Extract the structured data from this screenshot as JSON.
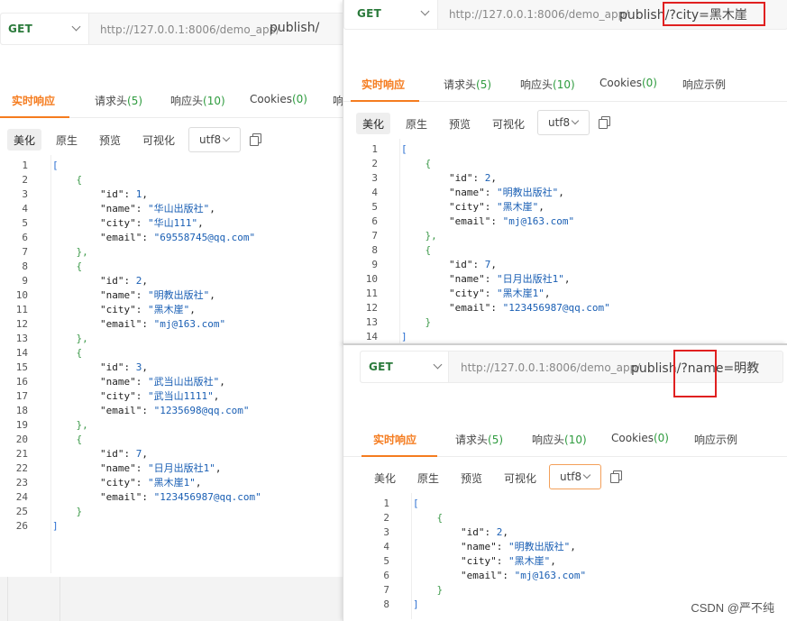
{
  "panels": [
    {
      "method": "GET",
      "host": "http://127.0.0.1:8006/demo_app/",
      "path": "publish/",
      "tabs": [
        {
          "label": "实时响应",
          "count": ""
        },
        {
          "label": "请求头",
          "count": "(5)"
        },
        {
          "label": "响应头",
          "count": "(10)"
        },
        {
          "label": "Cookies",
          "count": "(0)"
        },
        {
          "label": "响",
          "count": ""
        }
      ],
      "views": [
        "美化",
        "原生",
        "预览",
        "可视化"
      ],
      "encoding": "utf8",
      "code": [
        "[",
        "    {",
        "        \"id\": 1,",
        "        \"name\": \"华山出版社\",",
        "        \"city\": \"华山111\",",
        "        \"email\": \"69558745@qq.com\"",
        "    },",
        "    {",
        "        \"id\": 2,",
        "        \"name\": \"明教出版社\",",
        "        \"city\": \"黑木崖\",",
        "        \"email\": \"mj@163.com\"",
        "    },",
        "    {",
        "        \"id\": 3,",
        "        \"name\": \"武当山出版社\",",
        "        \"city\": \"武当山1111\",",
        "        \"email\": \"1235698@qq.com\"",
        "    },",
        "    {",
        "        \"id\": 7,",
        "        \"name\": \"日月出版社1\",",
        "        \"city\": \"黑木崖1\",",
        "        \"email\": \"123456987@qq.com\"",
        "    }",
        "]"
      ]
    },
    {
      "method": "GET",
      "host": "http://127.0.0.1:8006/demo_app/",
      "path": "publish/",
      "query": "?city=黑木崖",
      "tabs": [
        {
          "label": "实时响应",
          "count": ""
        },
        {
          "label": "请求头",
          "count": "(5)"
        },
        {
          "label": "响应头",
          "count": "(10)"
        },
        {
          "label": "Cookies",
          "count": "(0)"
        },
        {
          "label": "响应示例",
          "count": ""
        }
      ],
      "views": [
        "美化",
        "原生",
        "预览",
        "可视化"
      ],
      "encoding": "utf8",
      "code": [
        "[",
        "    {",
        "        \"id\": 2,",
        "        \"name\": \"明教出版社\",",
        "        \"city\": \"黑木崖\",",
        "        \"email\": \"mj@163.com\"",
        "    },",
        "    {",
        "        \"id\": 7,",
        "        \"name\": \"日月出版社1\",",
        "        \"city\": \"黑木崖1\",",
        "        \"email\": \"123456987@qq.com\"",
        "    }",
        "]"
      ]
    },
    {
      "method": "GET",
      "host": "http://127.0.0.1:8006/demo_app/",
      "path": "publish/",
      "query": "?name=明教",
      "tabs": [
        {
          "label": "实时响应",
          "count": ""
        },
        {
          "label": "请求头",
          "count": "(5)"
        },
        {
          "label": "响应头",
          "count": "(10)"
        },
        {
          "label": "Cookies",
          "count": "(0)"
        },
        {
          "label": "响应示例",
          "count": ""
        }
      ],
      "views": [
        "美化",
        "原生",
        "预览",
        "可视化"
      ],
      "encoding": "utf8",
      "code": [
        "[",
        "    {",
        "        \"id\": 2,",
        "        \"name\": \"明教出版社\",",
        "        \"city\": \"黑木崖\",",
        "        \"email\": \"mj@163.com\"",
        "    }",
        "]"
      ]
    }
  ],
  "watermark": "CSDN @严不纯",
  "colors": {
    "accent": "#f57c1f",
    "method": "#2a7a3b",
    "count": "#2e9b3e",
    "highlight_box": "#e02020"
  }
}
